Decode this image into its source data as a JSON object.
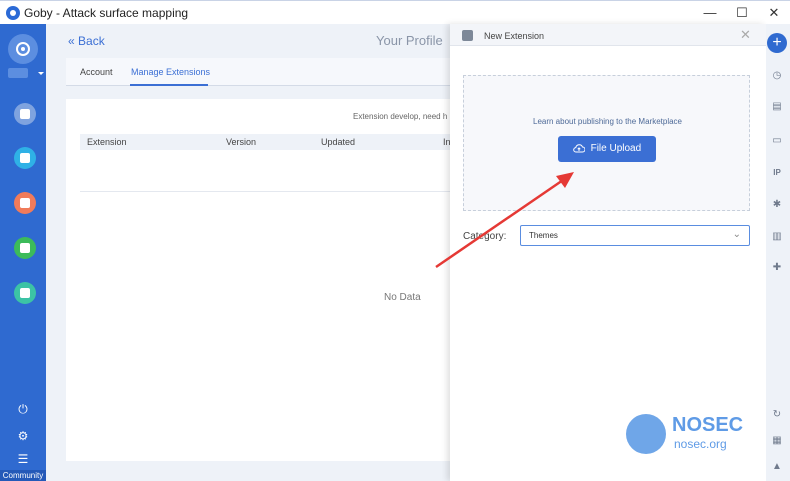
{
  "window": {
    "title": "Goby - Attack surface mapping",
    "minimize": "—",
    "maximize": "☐",
    "close": "✕"
  },
  "sidebar": {
    "community_label": "Community",
    "icons": [
      "rocket-icon",
      "server-icon",
      "list-icon",
      "bug-icon",
      "chart-icon",
      "extension-icon"
    ],
    "bottom_icons": [
      "power-icon",
      "settings-icon",
      "menu-icon"
    ]
  },
  "header": {
    "back_label": "Back",
    "page_title": "Your Profile"
  },
  "tabs": [
    {
      "label": "Account",
      "active": false
    },
    {
      "label": "Manage Extensions",
      "active": true
    }
  ],
  "extensions_table": {
    "hint": "Extension develop, need h",
    "columns": [
      "Extension",
      "Version",
      "Updated",
      "In"
    ],
    "empty_text": "No Data"
  },
  "modal": {
    "title": "New Extension",
    "close": "✕",
    "marketplace_text": "Learn about publishing to the Marketplace",
    "upload_label": "File Upload",
    "category_label": "Category:",
    "category_value": "Themes"
  },
  "right_bar": {
    "add": "+",
    "icons": [
      "clock-icon",
      "document-icon",
      "monitor-icon",
      "ip-icon",
      "bug-icon",
      "bar-chart-icon",
      "puzzle-icon",
      "refresh-icon",
      "report-icon",
      "warning-icon"
    ],
    "ip_label": "IP"
  },
  "watermark": {
    "name": "NOSEC",
    "url": "nosec.org"
  },
  "colors": {
    "accent": "#3b6fd4",
    "sidebar": "#2f6ad0",
    "arrow": "#e53935"
  }
}
